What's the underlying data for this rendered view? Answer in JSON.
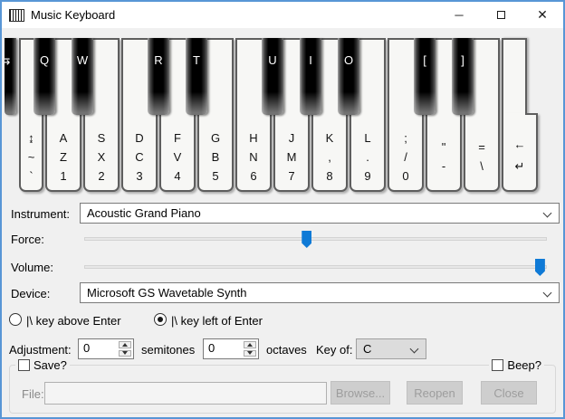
{
  "titlebar": {
    "title": "Music Keyboard",
    "icons": {
      "app": "piano-keys",
      "minimize": "─",
      "maximize": "window-outline",
      "close": "✕"
    }
  },
  "keyboard": {
    "white_keys": [
      {
        "lines": [
          "↨",
          "~",
          "`"
        ]
      },
      {
        "lines": [
          "A",
          "Z",
          "1"
        ]
      },
      {
        "lines": [
          "S",
          "X",
          "2"
        ]
      },
      {
        "lines": [
          "D",
          "C",
          "3"
        ]
      },
      {
        "lines": [
          "F",
          "V",
          "4"
        ]
      },
      {
        "lines": [
          "G",
          "B",
          "5"
        ]
      },
      {
        "lines": [
          "H",
          "N",
          "6"
        ]
      },
      {
        "lines": [
          "J",
          "M",
          "7"
        ]
      },
      {
        "lines": [
          "K",
          ",",
          "8"
        ]
      },
      {
        "lines": [
          "L",
          ".",
          "9"
        ]
      },
      {
        "lines": [
          ";",
          "/",
          "0"
        ]
      },
      {
        "lines": [
          "\"",
          "-"
        ]
      },
      {
        "lines": [
          "=",
          "\\"
        ]
      },
      {
        "lines": [
          "←",
          "↵"
        ]
      }
    ],
    "black_keys": [
      {
        "label": "⇆",
        "partial": true
      },
      {
        "label": "Q"
      },
      {
        "label": "W"
      },
      {
        "label": "R"
      },
      {
        "label": "T"
      },
      {
        "label": "U"
      },
      {
        "label": "I"
      },
      {
        "label": "O"
      },
      {
        "label": "["
      },
      {
        "label": "]"
      }
    ]
  },
  "controls": {
    "instrument": {
      "label": "Instrument:",
      "value": "Acoustic Grand Piano"
    },
    "force": {
      "label": "Force:",
      "percent": 48
    },
    "volume": {
      "label": "Volume:",
      "percent": 99
    },
    "device": {
      "label": "Device:",
      "value": "Microsoft GS Wavetable Synth"
    },
    "radios": {
      "above": {
        "label": "|\\ key above Enter"
      },
      "left": {
        "label": "|\\ key left of Enter"
      },
      "selected": "key-left-of-enter"
    },
    "adjustment": {
      "label": "Adjustment:",
      "semitones_value": "0",
      "semitones_label": "semitones",
      "octaves_value": "0",
      "octaves_label": "octaves"
    },
    "key_of": {
      "label": "Key of:",
      "value": "C"
    }
  },
  "footer": {
    "save_label": "Save?",
    "beep_label": "Beep?",
    "save_checked": false,
    "beep_checked": false,
    "file_label": "File:",
    "file_value": "",
    "browse_label": "Browse...",
    "reopen_label": "Reopen",
    "close_label": "Close"
  },
  "colors": {
    "accent_border": "#5896d6",
    "slider_thumb": "#0f7ad6",
    "titlebar_bg": "#ffffff",
    "client_bg": "#f0f0f0"
  }
}
